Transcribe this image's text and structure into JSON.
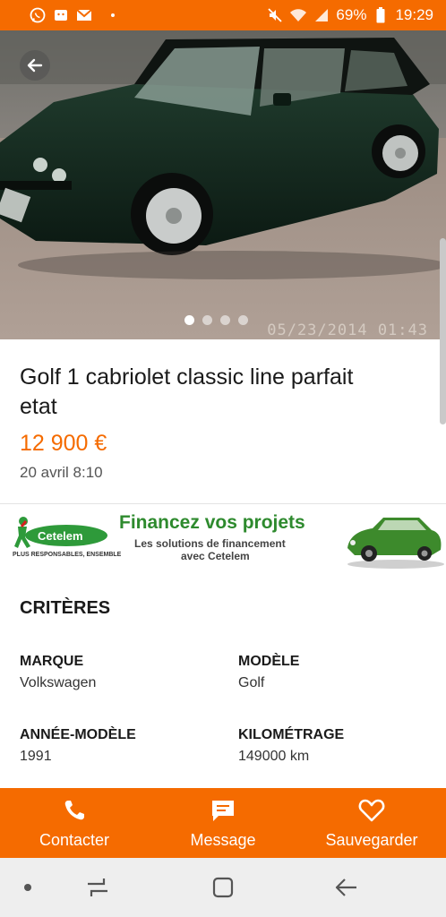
{
  "status_bar": {
    "battery": "69%",
    "time": "19:29",
    "icons": [
      "whatsapp-icon",
      "android-icon",
      "gmail-icon",
      "mute-icon",
      "wifi-icon",
      "signal-icon",
      "battery-icon"
    ]
  },
  "gallery": {
    "photo_timestamp": "05/23/2014  01:43",
    "dot_count": 4,
    "active_index": 0
  },
  "ad": {
    "title": "Golf 1 cabriolet classic line parfait etat",
    "price": "12 900 €",
    "date": "20 avril 8:10"
  },
  "banner": {
    "brand": "Cetelem",
    "tagline": "PLUS RESPONSABLES, ENSEMBLE",
    "headline": "Financez vos projets",
    "subline1": "Les solutions de financement",
    "subline2": "avec Cetelem"
  },
  "criteria": {
    "heading": "CRITÈRES",
    "items": [
      {
        "label": "MARQUE",
        "value": "Volkswagen"
      },
      {
        "label": "MODÈLE",
        "value": "Golf"
      },
      {
        "label": "ANNÉE-MODÈLE",
        "value": "1991"
      },
      {
        "label": "KILOMÉTRAGE",
        "value": "149000 km"
      }
    ]
  },
  "actions": {
    "contact": "Contacter",
    "message": "Message",
    "save": "Sauvegarder"
  },
  "colors": {
    "accent": "#f56b00",
    "banner_green": "#2e8a2e"
  }
}
